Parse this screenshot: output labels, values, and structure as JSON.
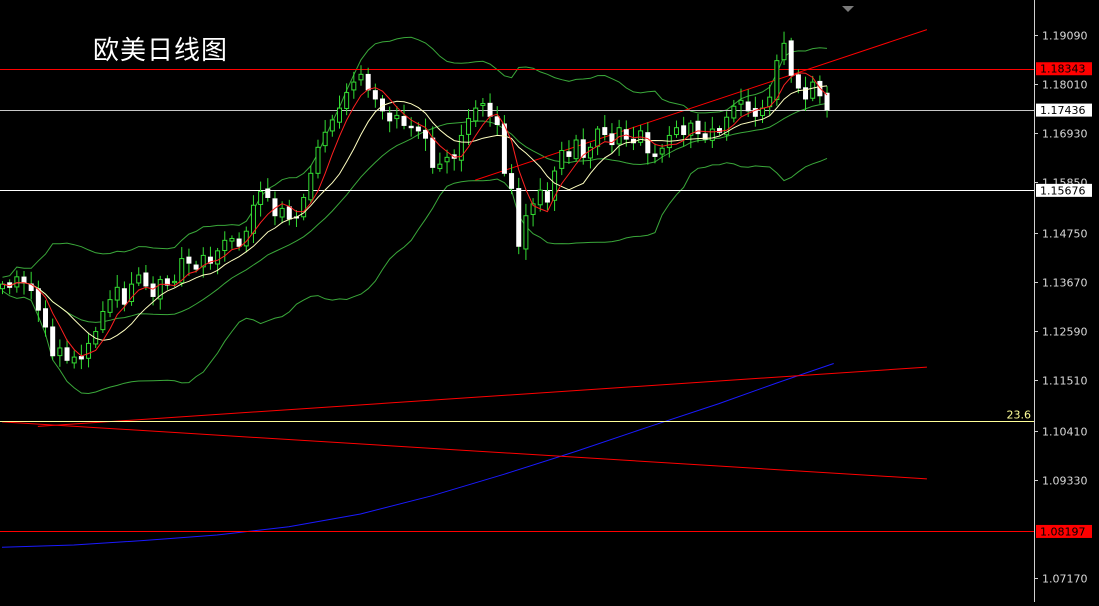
{
  "chart_data": {
    "type": "candlestick",
    "title": "欧美日线图",
    "y_range": [
      1.0665,
      1.1985
    ],
    "y_ticks": [
      1.1909,
      1.1801,
      1.1693,
      1.1585,
      1.1475,
      1.1367,
      1.1259,
      1.1151,
      1.1041,
      1.0933,
      1.0717
    ],
    "y_tick_labels": [
      "1.19090",
      "1.18010",
      "1.16930",
      "1.15850",
      "1.14750",
      "1.13670",
      "1.12590",
      "1.11510",
      "1.10410",
      "1.09330",
      "1.07170"
    ],
    "price_tags": [
      {
        "value": 1.18343,
        "label": "1.18343",
        "color": "#ff0000"
      },
      {
        "value": 1.17436,
        "label": "1.17436",
        "color": "#ffffff"
      },
      {
        "value": 1.15676,
        "label": "1.15676",
        "color": "#ffffff"
      },
      {
        "value": 1.08197,
        "label": "1.08197",
        "color": "#ff0000"
      }
    ],
    "horizontal_lines": [
      {
        "value": 1.18343,
        "color": "#ff0000"
      },
      {
        "value": 1.17436,
        "color": "#c8c8c8"
      },
      {
        "value": 1.15676,
        "color": "#ffffff"
      },
      {
        "value": 1.08197,
        "color": "#ff0000"
      },
      {
        "value": 1.1061,
        "color": "#ffff99"
      }
    ],
    "fib_label": {
      "text": "23.6",
      "color": "#ffff99"
    },
    "bar_count": 116,
    "closes": [
      1.1362,
      1.1355,
      1.1378,
      1.1365,
      1.1348,
      1.1305,
      1.1268,
      1.1205,
      1.1222,
      1.1195,
      1.1202,
      1.1198,
      1.1232,
      1.1258,
      1.1302,
      1.1328,
      1.1355,
      1.1318,
      1.1362,
      1.1382,
      1.1358,
      1.1335,
      1.1372,
      1.136,
      1.1368,
      1.1418,
      1.1408,
      1.1395,
      1.1425,
      1.1408,
      1.1435,
      1.1458,
      1.1462,
      1.1445,
      1.1478,
      1.1535,
      1.1565,
      1.1552,
      1.1512,
      1.1528,
      1.1505,
      1.1508,
      1.1552,
      1.1605,
      1.1662,
      1.1695,
      1.1722,
      1.1748,
      1.1782,
      1.1805,
      1.1822,
      1.1788,
      1.1768,
      1.1742,
      1.172,
      1.1732,
      1.171,
      1.1705,
      1.1698,
      1.1682,
      1.1618,
      1.1625,
      1.164,
      1.1638,
      1.1688,
      1.1725,
      1.1748,
      1.1758,
      1.173,
      1.1712,
      1.1605,
      1.1572,
      1.1445,
      1.1512,
      1.1538,
      1.1568,
      1.1542,
      1.161,
      1.1655,
      1.1642,
      1.1678,
      1.164,
      1.1662,
      1.1702,
      1.169,
      1.1668,
      1.1705,
      1.168,
      1.1672,
      1.1698,
      1.165,
      1.1642,
      1.166,
      1.1688,
      1.1705,
      1.169,
      1.1715,
      1.1692,
      1.168,
      1.1702,
      1.1695,
      1.1728,
      1.1752,
      1.1765,
      1.1742,
      1.173,
      1.1748,
      1.1772,
      1.1852,
      1.189,
      1.182,
      1.1792,
      1.1768,
      1.1805,
      1.1775,
      1.1744
    ],
    "ma_fast": {
      "color": "#ff2020"
    },
    "ma_slow": {
      "color": "#ffffc0"
    },
    "bollinger": {
      "color": "#3aa83a"
    },
    "long_ma": {
      "color": "#1a1aff",
      "points": [
        [
          0,
          1.0785
        ],
        [
          10,
          1.079
        ],
        [
          20,
          1.08
        ],
        [
          30,
          1.0812
        ],
        [
          40,
          1.083
        ],
        [
          50,
          1.0858
        ],
        [
          60,
          1.0898
        ],
        [
          70,
          1.0945
        ],
        [
          80,
          1.0995
        ],
        [
          90,
          1.1048
        ],
        [
          100,
          1.11
        ],
        [
          108,
          1.1145
        ],
        [
          116,
          1.1188
        ]
      ]
    },
    "trendlines": [
      {
        "color": "#ff0000",
        "from": [
          5,
          1.105
        ],
        "to": [
          129,
          1.118
        ]
      },
      {
        "color": "#ff0000",
        "from": [
          0,
          1.106
        ],
        "to": [
          129,
          1.0935
        ]
      },
      {
        "color": "#ff0000",
        "from": [
          66,
          1.159
        ],
        "to": [
          129,
          1.192
        ]
      }
    ],
    "legend": "none",
    "grid": false
  }
}
